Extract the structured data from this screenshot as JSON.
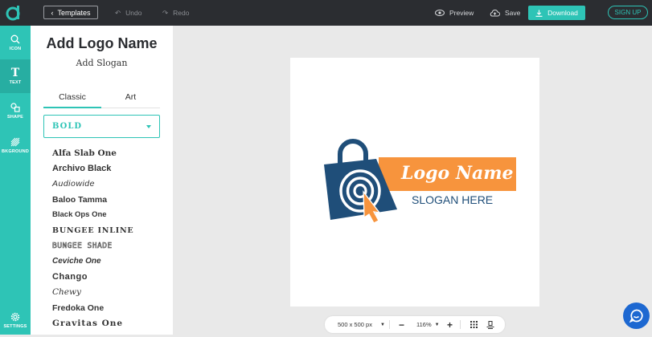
{
  "topbar": {
    "templates_label": "Templates",
    "undo_label": "Undo",
    "redo_label": "Redo",
    "preview_label": "Preview",
    "save_label": "Save",
    "download_label": "Download",
    "signup_label": "SIGN UP"
  },
  "rail": {
    "items": [
      {
        "label": "ICON",
        "icon": "search-icon"
      },
      {
        "label": "TEXT",
        "icon": "text-icon"
      },
      {
        "label": "SHAPE",
        "icon": "shapes-icon"
      },
      {
        "label": "BKGROUND",
        "icon": "background-icon"
      },
      {
        "label": "SETTINGS",
        "icon": "gear-icon"
      }
    ]
  },
  "panel": {
    "logo_name": "Add Logo Name",
    "slogan": "Add Slogan",
    "tabs": [
      "Classic",
      "Art"
    ],
    "category": "BOLD",
    "fonts": [
      "Alfa Slab One",
      "Archivo Black",
      "Audiowide",
      "Baloo Tamma",
      "Black Ops One",
      "BUNGEE INLINE",
      "BUNGEE SHADE",
      "Ceviche One",
      "Chango",
      "Chewy",
      "Fredoka One",
      "Gravitas One"
    ]
  },
  "logo": {
    "name": "Logo Name",
    "slogan": "SLOGAN HERE",
    "colors": {
      "navy": "#1f4e79",
      "orange": "#f7943d",
      "white": "#ffffff"
    }
  },
  "bottombar": {
    "size_label": "500 x 500 px",
    "zoom_label": "116%"
  },
  "colors": {
    "accent": "#2ec4b6",
    "topbar": "#2b2d31",
    "chat": "#1d68d1"
  }
}
